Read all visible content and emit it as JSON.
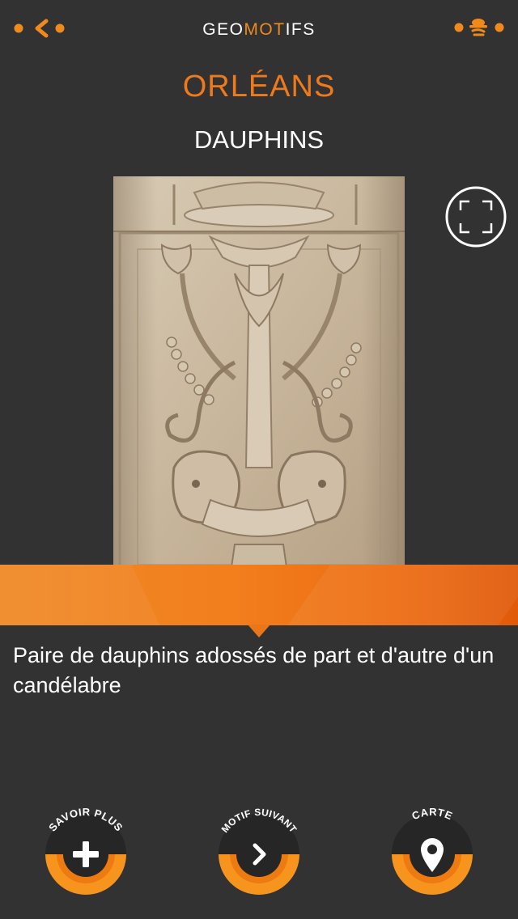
{
  "header": {
    "brand_part1": "GEO",
    "brand_part2": "MOT",
    "brand_part3": "IFS"
  },
  "place": {
    "city": "ORLÉANS",
    "motif_title": "DAUPHINS"
  },
  "description": "Paire de dauphins adossés de part et d'autre d'un candélabre",
  "actions": {
    "more": "SAVOIR PLUS",
    "next": "MOTIF SUIVANT",
    "map": "CARTE"
  },
  "colors": {
    "accent": "#f08a1d",
    "background": "#323232",
    "banner": "#f27e1c"
  },
  "icons": {
    "back": "back-arrow-icon",
    "profile": "explorer-hat-icon",
    "fullscreen": "fullscreen-icon",
    "more": "plus-icon",
    "next": "chevron-right-icon",
    "map": "map-pin-icon"
  }
}
